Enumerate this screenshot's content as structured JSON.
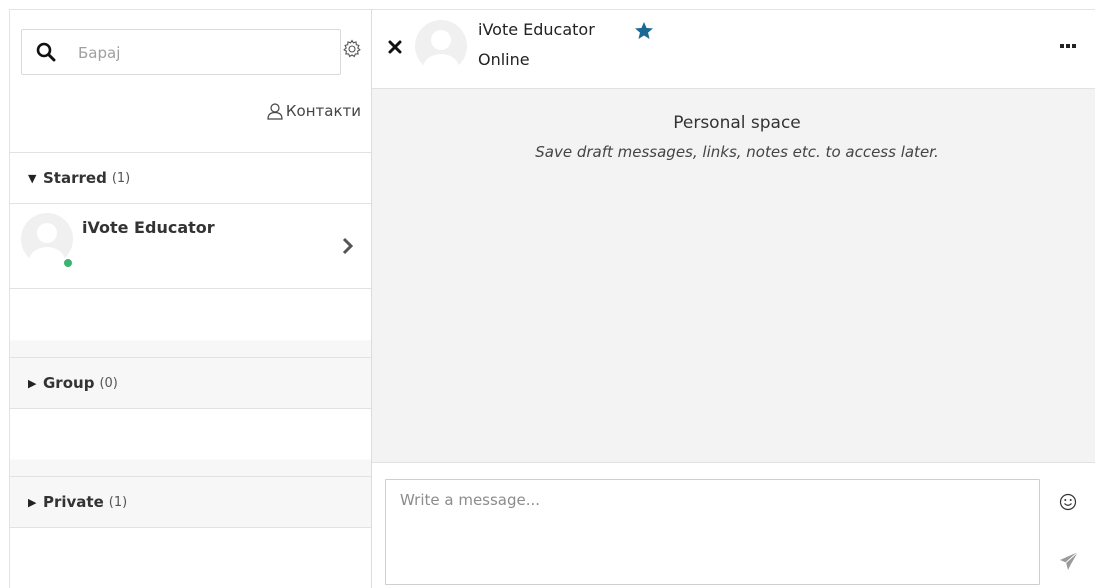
{
  "sidebar": {
    "search": {
      "placeholder": "Барај",
      "value": ""
    },
    "contacts_label": "Контакти",
    "sections": {
      "starred": {
        "label": "Starred",
        "count": "(1)",
        "expanded": true
      },
      "group": {
        "label": "Group",
        "count": "(0)",
        "expanded": false
      },
      "private": {
        "label": "Private",
        "count": "(1)",
        "expanded": false
      }
    },
    "starred_contacts": [
      {
        "name": "iVote Educator",
        "online": true
      }
    ]
  },
  "conversation": {
    "name": "iVote Educator",
    "status": "Online",
    "starred": true,
    "personal_space_title": "Personal space",
    "personal_space_subtitle": "Save draft messages, links, notes etc. to access later.",
    "composer": {
      "placeholder": "Write a message...",
      "value": ""
    }
  },
  "icons": {
    "search": "search-icon",
    "settings": "gear-icon",
    "contacts": "user-icon",
    "close": "close-icon",
    "star": "star-icon",
    "more": "more-options-icon",
    "emoji": "emoji-icon",
    "send": "send-icon",
    "chevron": "chevron-right-icon"
  },
  "colors": {
    "star": "#1b6994",
    "online": "#3cb371",
    "panel_bg": "#f3f3f3"
  }
}
